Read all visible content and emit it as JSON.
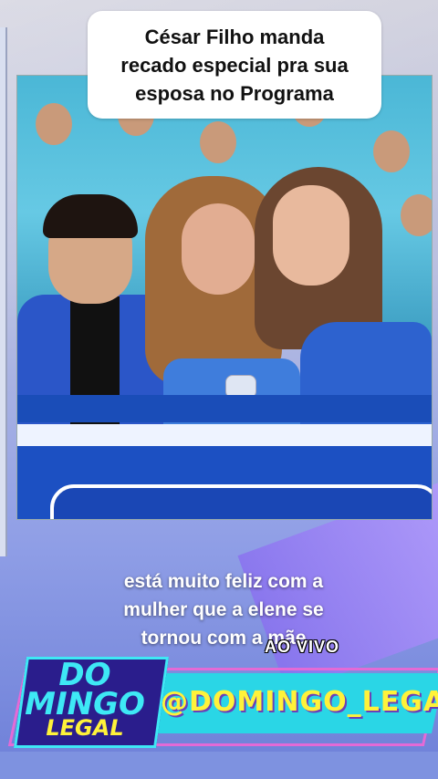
{
  "video": {
    "title_lines": [
      "César Filho manda",
      "recado especial pra sua",
      "esposa no Programa"
    ],
    "subtitle_lines": [
      "está muito feliz com a",
      "mulher que a elene se",
      "tornou com a mãe"
    ],
    "live_label": "AO VIVO"
  },
  "show": {
    "handle": "@DOMINGO_LEGAL",
    "logo_lines": [
      "DO",
      "MINGO",
      "LEGAL"
    ]
  }
}
